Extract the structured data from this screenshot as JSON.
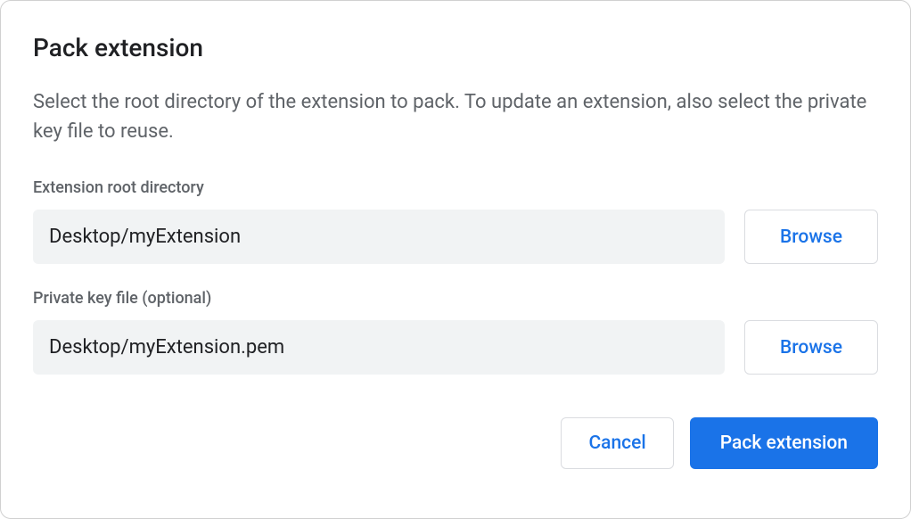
{
  "dialog": {
    "title": "Pack extension",
    "description": "Select the root directory of the extension to pack. To update an extension, also select the private key file to reuse.",
    "fields": {
      "root_directory": {
        "label": "Extension root directory",
        "value": "Desktop/myExtension",
        "browse_label": "Browse"
      },
      "private_key": {
        "label": "Private key file (optional)",
        "value": "Desktop/myExtension.pem",
        "browse_label": "Browse"
      }
    },
    "footer": {
      "cancel_label": "Cancel",
      "primary_label": "Pack extension"
    }
  }
}
